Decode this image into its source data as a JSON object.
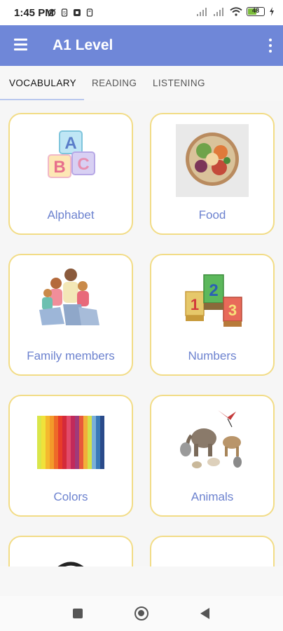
{
  "status_bar": {
    "time": "1:45 PM",
    "battery_level": "48",
    "battery_percent": 48,
    "icons": [
      "no-alarm-icon",
      "sim-icon",
      "notification-icon",
      "storage-icon",
      "signal-icon",
      "signal-icon",
      "wifi-icon",
      "battery-icon",
      "charging-icon"
    ]
  },
  "app_bar": {
    "title": "A1 Level"
  },
  "tabs": [
    {
      "label": "VOCABULARY",
      "active": true
    },
    {
      "label": "READING",
      "active": false
    },
    {
      "label": "LISTENING",
      "active": false
    }
  ],
  "cards": [
    {
      "label": "Alphabet",
      "image": "abc-blocks-image"
    },
    {
      "label": "Food",
      "image": "food-bowl-image"
    },
    {
      "label": "Family members",
      "image": "family-photo-image"
    },
    {
      "label": "Numbers",
      "image": "number-blocks-image"
    },
    {
      "label": "Colors",
      "image": "color-stripes-image"
    },
    {
      "label": "Animals",
      "image": "animals-image"
    },
    {
      "label": "",
      "image": "telephone-image"
    },
    {
      "label": "",
      "image": "globe-image"
    }
  ],
  "colors": {
    "app_bar": "#6f87d8",
    "card_border": "#f2dc86",
    "card_label": "#6c82cf",
    "tab_indicator": "#b9c8ee"
  }
}
